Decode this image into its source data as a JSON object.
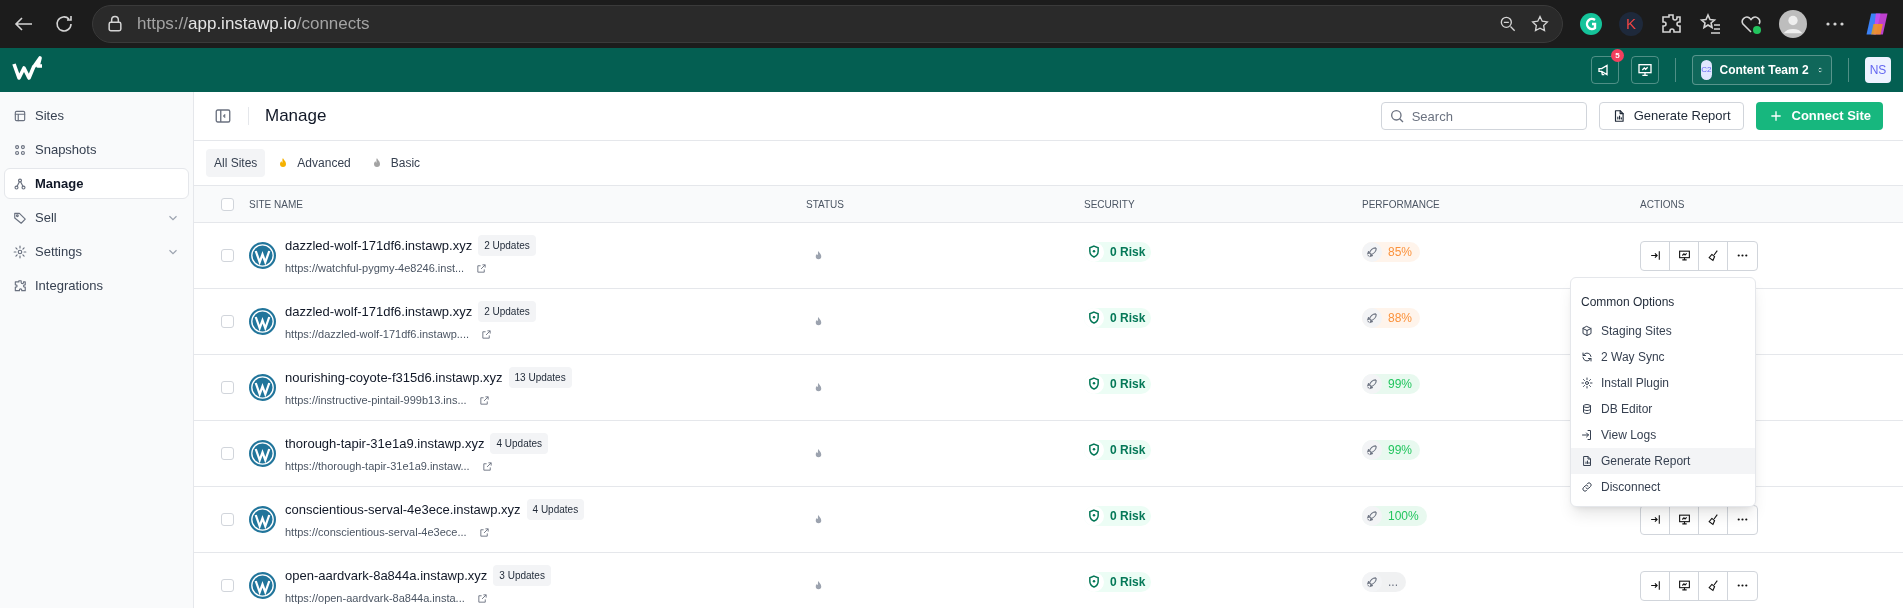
{
  "browser": {
    "url_scheme": "https://",
    "url_host": "app.instawp.io",
    "url_path": "/connects",
    "extension_letter": "K"
  },
  "header": {
    "notification_count": "5",
    "team_initials": "C2",
    "team_name": "Content Team 2",
    "user_initials": "NS"
  },
  "sidebar": {
    "items": [
      {
        "label": "Sites",
        "kind": "layout",
        "selected": false,
        "expandable": false
      },
      {
        "label": "Snapshots",
        "kind": "grid",
        "selected": false,
        "expandable": false
      },
      {
        "label": "Manage",
        "kind": "nodes",
        "selected": true,
        "expandable": false
      },
      {
        "label": "Sell",
        "kind": "tag",
        "selected": false,
        "expandable": true
      },
      {
        "label": "Settings",
        "kind": "gear",
        "selected": false,
        "expandable": true
      },
      {
        "label": "Integrations",
        "kind": "puzzle",
        "selected": false,
        "expandable": false
      }
    ]
  },
  "page": {
    "title": "Manage",
    "search": {
      "placeholder": "Search"
    },
    "buttons": [
      {
        "label": "Generate Report",
        "kind": "outline"
      },
      {
        "label": "Connect Site",
        "kind": "primary"
      }
    ]
  },
  "tabs": [
    {
      "label": "All Sites",
      "selected": true
    },
    {
      "label": "Advanced",
      "selected": false,
      "color": "#f5b100"
    },
    {
      "label": "Basic",
      "selected": false,
      "color": "#a3a3a3"
    }
  ],
  "table": {
    "select_all_checked": false,
    "columns": [
      "SITE NAME",
      "STATUS",
      "SECURITY",
      "PERFORMANCE",
      "ACTIONS"
    ],
    "rows": [
      {
        "name": "dazzled-wolf-171df6.instawp.xyz",
        "updates": "2 Updates",
        "url": "https://watchful-pygmy-4e8246.inst...",
        "checked": false,
        "security": "0 Risk",
        "performance": "85%",
        "color": "#fb923c",
        "actions_shown": true
      },
      {
        "name": "dazzled-wolf-171df6.instawp.xyz",
        "updates": "2 Updates",
        "url": "https://dazzled-wolf-171df6.instawp....",
        "checked": false,
        "security": "0 Risk",
        "performance": "88%",
        "color": "#fb923c",
        "actions_shown": false
      },
      {
        "name": "nourishing-coyote-f315d6.instawp.xyz",
        "updates": "13 Updates",
        "url": "https://instructive-pintail-999b13.ins...",
        "checked": false,
        "security": "0 Risk",
        "performance": "99%",
        "color": "#22c55e",
        "actions_shown": false
      },
      {
        "name": "thorough-tapir-31e1a9.instawp.xyz",
        "updates": "4 Updates",
        "url": "https://thorough-tapir-31e1a9.instaw...",
        "checked": false,
        "security": "0 Risk",
        "performance": "99%",
        "color": "#22c55e",
        "actions_shown": false
      },
      {
        "name": "conscientious-serval-4e3ece.instawp.xyz",
        "updates": "4 Updates",
        "url": "https://conscientious-serval-4e3ece...",
        "checked": false,
        "security": "0 Risk",
        "performance": "100%",
        "color": "#22c55e",
        "actions_shown": true
      },
      {
        "name": "open-aardvark-8a844a.instawp.xyz",
        "updates": "3 Updates",
        "url": "https://open-aardvark-8a844a.insta...",
        "checked": false,
        "security": "0 Risk",
        "performance": "...",
        "color": "#6b7280",
        "actions_shown": true
      }
    ]
  },
  "menu": {
    "title": "Common Options",
    "items": [
      {
        "label": "Staging Sites",
        "kind": "cube",
        "selected": false
      },
      {
        "label": "2 Way Sync",
        "kind": "sync",
        "selected": false
      },
      {
        "label": "Install Plugin",
        "kind": "gear",
        "selected": false
      },
      {
        "label": "DB Editor",
        "kind": "database",
        "selected": false
      },
      {
        "label": "View Logs",
        "kind": "login",
        "selected": false
      },
      {
        "label": "Generate Report",
        "kind": "report",
        "selected": true
      },
      {
        "label": "Disconnect",
        "kind": "link",
        "selected": false
      }
    ]
  }
}
